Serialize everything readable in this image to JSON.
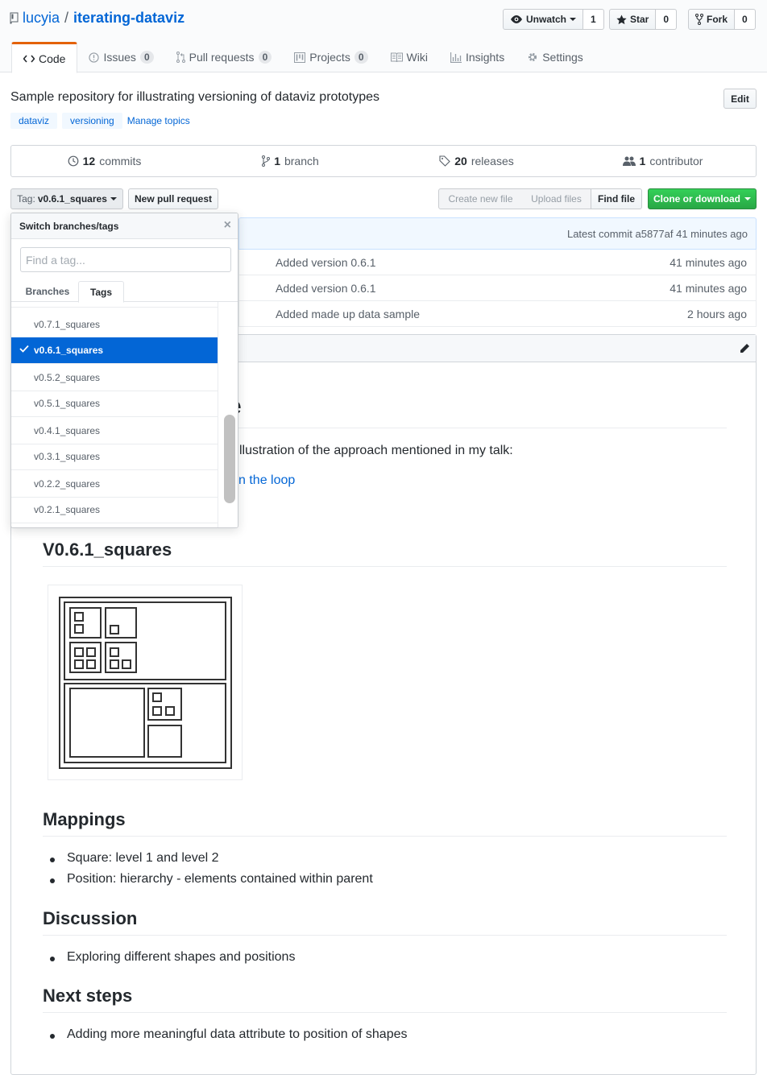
{
  "repo": {
    "owner": "lucyia",
    "slash": "/",
    "name": "iterating-dataviz"
  },
  "header_actions": [
    {
      "label": "Unwatch",
      "count": "1"
    },
    {
      "label": "Star",
      "count": "0"
    },
    {
      "label": "Fork",
      "count": "0"
    }
  ],
  "tabs": [
    {
      "label": "Code",
      "active": true
    },
    {
      "label": "Issues",
      "count": "0"
    },
    {
      "label": "Pull requests",
      "count": "0"
    },
    {
      "label": "Projects",
      "count": "0"
    },
    {
      "label": "Wiki"
    },
    {
      "label": "Insights"
    },
    {
      "label": "Settings"
    }
  ],
  "description": "Sample repository for illustrating versioning of dataviz prototypes",
  "edit_label": "Edit",
  "topics": [
    "dataviz",
    "versioning"
  ],
  "manage_topics": "Manage topics",
  "numbers": [
    {
      "value": "12",
      "label": "commits"
    },
    {
      "value": "1",
      "label": "branch"
    },
    {
      "value": "20",
      "label": "releases"
    },
    {
      "value": "1",
      "label": "contributor"
    }
  ],
  "toolbar": {
    "tag_prefix": "Tag:",
    "tag_value": "v0.6.1_squares",
    "new_pr": "New pull request",
    "create_file": "Create new file",
    "upload_files": "Upload files",
    "find_file": "Find file",
    "clone": "Clone or download"
  },
  "commit_bar": {
    "text": "Latest commit a5877af 41 minutes ago"
  },
  "files": [
    {
      "message": "Added version 0.6.1",
      "age": "41 minutes ago"
    },
    {
      "message": "Added version 0.6.1",
      "age": "41 minutes ago"
    },
    {
      "message": "Added made up data sample",
      "age": "2 hours ago"
    }
  ],
  "dropdown": {
    "title": "Switch branches/tags",
    "filter_placeholder": "Find a tag...",
    "tab_branches": "Branches",
    "tab_tags": "Tags",
    "items": [
      "v0.7.1_squares",
      "v0.6.1_squares",
      "v0.5.2_squares",
      "v0.5.1_squares",
      "v0.4.1_squares",
      "v0.3.1_squares",
      "v0.2.2_squares",
      "v0.2.1_squares"
    ],
    "selected_index": 1
  },
  "readme": {
    "title_fragment": "e",
    "intro_fragment": "llustration of the approach mentioned in my talk:",
    "link_fragment": "n the loop",
    "version_heading": "V0.6.1_squares",
    "mappings_heading": "Mappings",
    "mappings": [
      "Square: level 1 and level 2",
      "Position: hierarchy - elements contained within parent"
    ],
    "discussion_heading": "Discussion",
    "discussion": [
      "Exploring different shapes and positions"
    ],
    "next_heading": "Next steps",
    "next": [
      "Adding more meaningful data attribute to position of shapes"
    ]
  },
  "colors": {
    "link": "#0366d6",
    "accent_tab": "#e36209",
    "clone_green": "#28a745",
    "selected": "#0366d6"
  }
}
